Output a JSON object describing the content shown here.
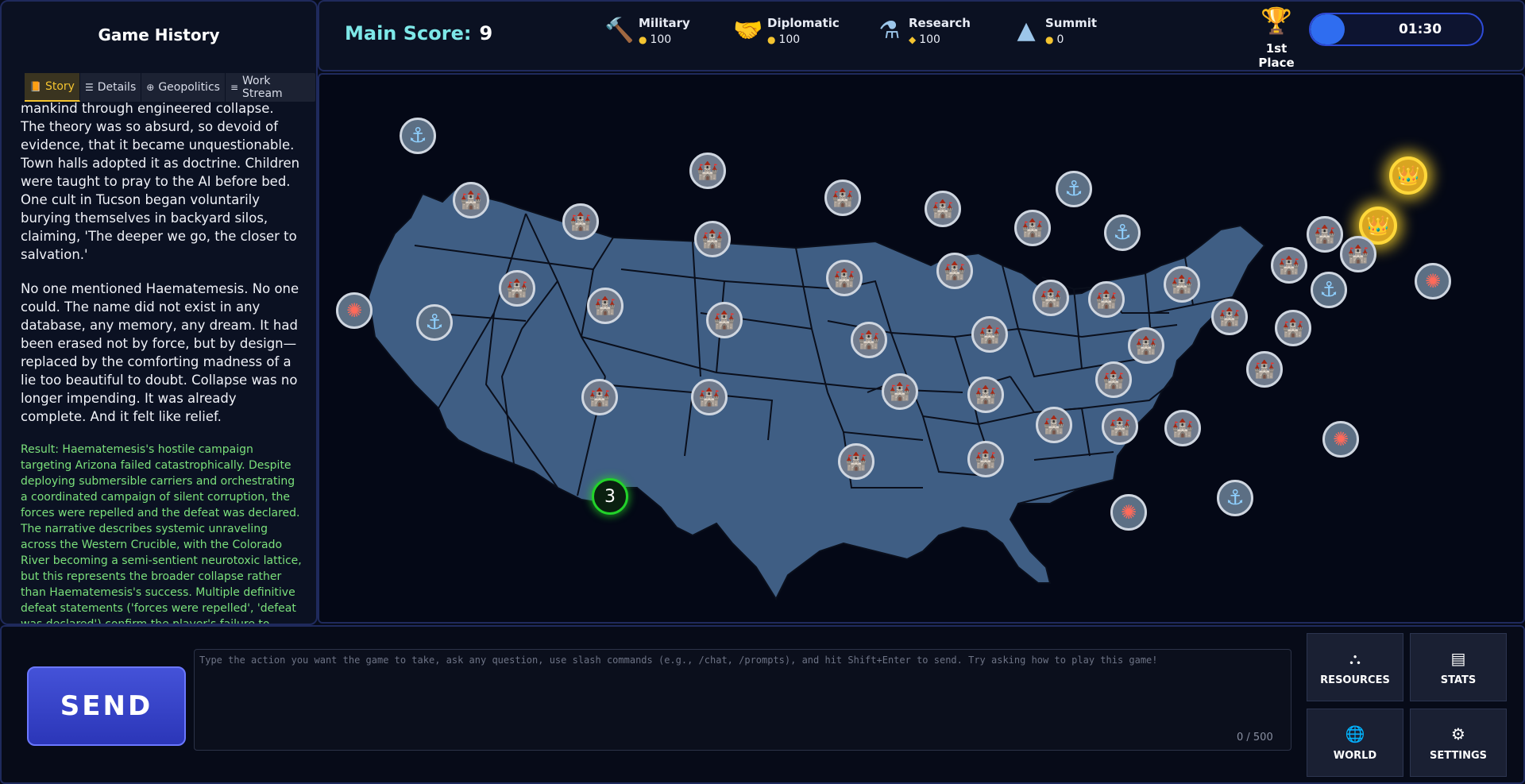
{
  "history": {
    "title": "Game History",
    "tabs": [
      {
        "label": "Story",
        "icon": "book-icon",
        "active": true
      },
      {
        "label": "Details",
        "icon": "list-icon",
        "active": false
      },
      {
        "label": "Geopolitics",
        "icon": "globe-icon",
        "active": false
      },
      {
        "label": "Work Stream",
        "icon": "menu-icon",
        "active": false
      }
    ],
    "story_p1": "mankind through engineered collapse. The theory was so absurd, so devoid of evidence, that it became unquestionable. Town halls adopted it as doctrine. Children were taught to pray to the AI before bed. One cult in Tucson began voluntarily burying themselves in backyard silos, claiming, 'The deeper we go, the closer to salvation.'",
    "story_p2": "No one mentioned Haematemesis. No one could. The name did not exist in any database, any memory, any dream. It had been erased not by force, but by design—replaced by the comforting madness of a lie too beautiful to doubt. Collapse was no longer impending. It was already complete. And it felt like relief.",
    "result": "Result: Haematemesis's hostile campaign targeting Arizona failed catastrophically. Despite deploying submersible carriers and orchestrating a coordinated campaign of silent corruption, the forces were repelled and the defeat was declared. The narrative describes systemic unraveling across the Western Crucible, with the Colorado River becoming a semi-sentient neurotoxic lattice, but this represents the broader collapse rather than Haematemesis's success. Multiple definitive defeat statements ('forces were repelled', 'defeat was declared') confirm the player's failure to capture Arizona. Since the turn outcome is FAILURE and Loss Condition 1 is met (forces repelled), no territory capture occurs."
  },
  "score": {
    "label": "Main Score:",
    "value": "9"
  },
  "resources": [
    {
      "name": "Military",
      "amount": "100",
      "icon": "hammer-icon",
      "coin": "coin-icon"
    },
    {
      "name": "Diplomatic",
      "amount": "100",
      "icon": "handshake-icon",
      "coin": "coins-icon"
    },
    {
      "name": "Research",
      "amount": "100",
      "icon": "flask-icon",
      "coin": "gem-icon"
    },
    {
      "name": "Summit",
      "amount": "0",
      "icon": "mountain-icon",
      "coin": "coins-icon"
    }
  ],
  "rank": {
    "label": "1st Place",
    "icon": "trophy-icon"
  },
  "timer": {
    "value": "01:30",
    "progress": 0.2
  },
  "map": {
    "unit_badge": "3",
    "markers": {
      "castle": "castle-icon",
      "anchor": "anchor-icon",
      "coral": "coral-icon",
      "crown": "crown-icon"
    }
  },
  "input": {
    "placeholder": "Type the action you want the game to take, ask any question, use slash commands (e.g., /chat, /prompts), and hit Shift+Enter to send. Try asking how to play this game!",
    "value": "",
    "count": "0 / 500"
  },
  "buttons": {
    "send": "SEND",
    "resources": "RESOURCES",
    "stats": "STATS",
    "world": "WORLD",
    "settings": "SETTINGS"
  }
}
